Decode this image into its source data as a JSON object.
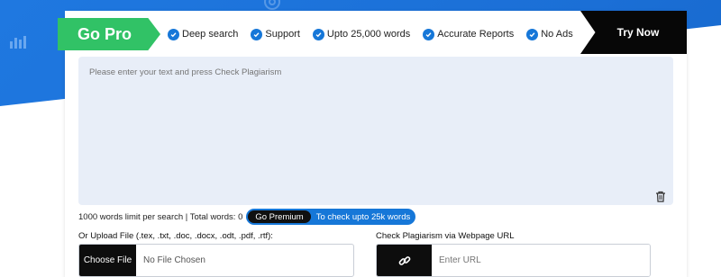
{
  "banner": {
    "go_pro": "Go Pro",
    "features": [
      "Deep search",
      "Support",
      "Upto 25,000 words",
      "Accurate Reports",
      "No Ads"
    ],
    "try_now": "Try Now"
  },
  "editor": {
    "placeholder": "Please enter your text and press Check Plagiarism"
  },
  "limits": {
    "text": "1000 words limit per search | Total words: 0",
    "premium_button": "Go Premium",
    "premium_text": "To check upto 25k words"
  },
  "upload": {
    "label": "Or Upload File (.tex, .txt, .doc, .docx, .odt, .pdf, .rtf):",
    "button": "Choose File",
    "status": "No File Chosen"
  },
  "url": {
    "label": "Check Plagiarism via Webpage URL",
    "placeholder": "Enter URL"
  },
  "colors": {
    "accent_blue": "#1677d8",
    "green": "#31c266",
    "black": "#070707"
  },
  "icons": {
    "feature": "check-circle-icon",
    "trash": "trash-icon",
    "link": "link-icon"
  }
}
